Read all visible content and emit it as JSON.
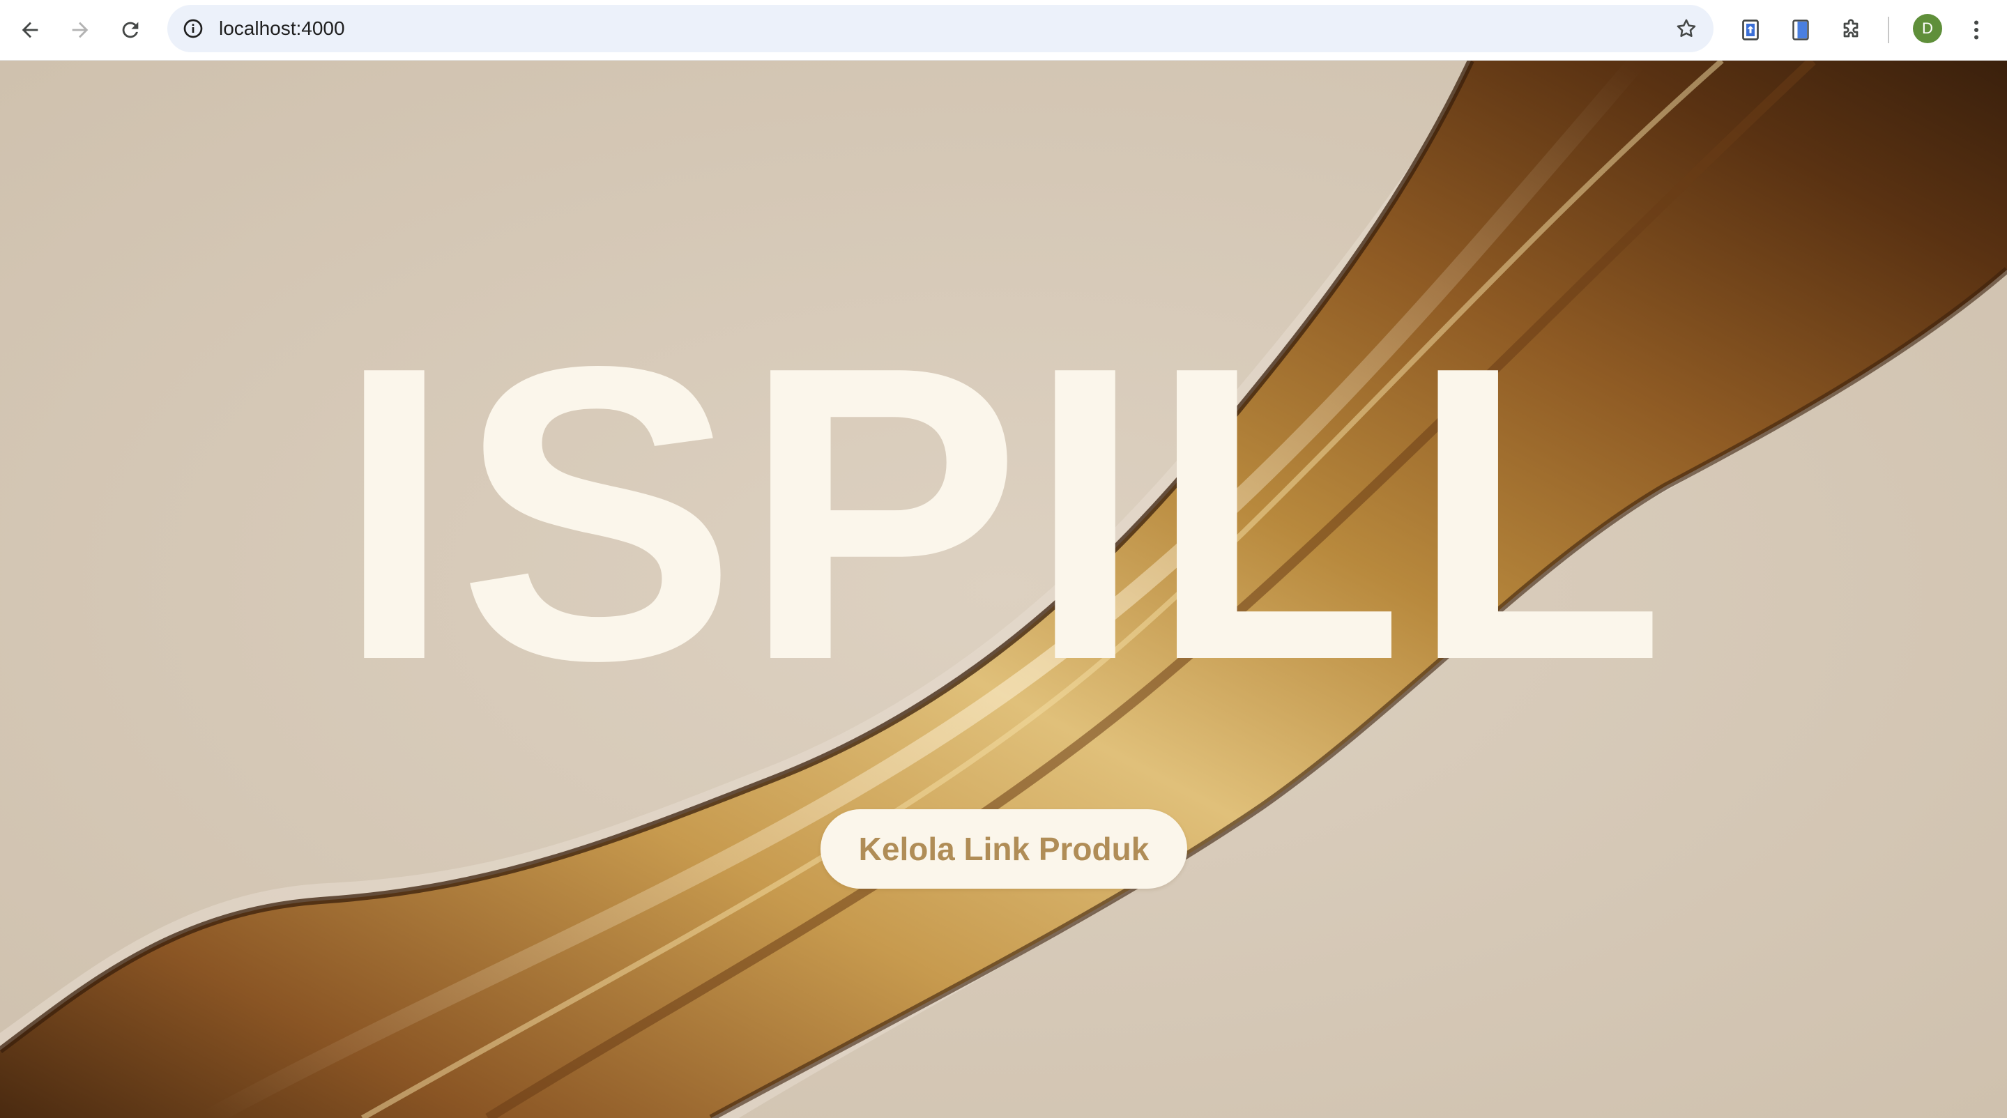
{
  "browser": {
    "url": "localhost:4000",
    "profile_initial": "D",
    "icons": {
      "back": "back-arrow-icon",
      "forward": "forward-arrow-icon",
      "reload": "reload-icon",
      "site_info": "info-icon",
      "bookmark": "star-icon",
      "extension_1": "upload-extension-icon",
      "extension_2": "clipboard-extension-icon",
      "extensions": "puzzle-icon",
      "menu": "kebab-menu-icon"
    }
  },
  "hero": {
    "title": "ISPILL",
    "cta_label": "Kelola Link Produk"
  },
  "colors": {
    "background": "#d6c9b8",
    "title": "#fbf6eb",
    "button_bg": "#fbf6eb",
    "button_text": "#b08d57",
    "liquid_gold": "#b8893d",
    "liquid_dark": "#5a3212"
  }
}
